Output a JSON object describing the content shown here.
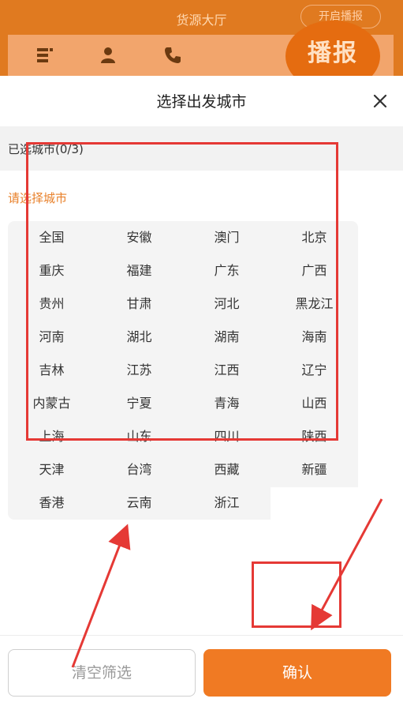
{
  "background": {
    "title": "货源大厅",
    "toggle_label": "开启播报",
    "bobao_label": "播报"
  },
  "sheet": {
    "title": "选择出发城市",
    "selected_label": "已选城市(0/3)",
    "prompt": "请选择城市"
  },
  "cities": [
    "全国",
    "安徽",
    "澳门",
    "北京",
    "重庆",
    "福建",
    "广东",
    "广西",
    "贵州",
    "甘肃",
    "河北",
    "黑龙江",
    "河南",
    "湖北",
    "湖南",
    "海南",
    "吉林",
    "江苏",
    "江西",
    "辽宁",
    "内蒙古",
    "宁夏",
    "青海",
    "山西",
    "上海",
    "山东",
    "四川",
    "陕西",
    "天津",
    "台湾",
    "西藏",
    "新疆",
    "香港",
    "云南",
    "浙江"
  ],
  "footer": {
    "clear_label": "清空筛选",
    "confirm_label": "确认"
  },
  "colors": {
    "accent": "#f07a23",
    "annotation": "#e53935"
  }
}
